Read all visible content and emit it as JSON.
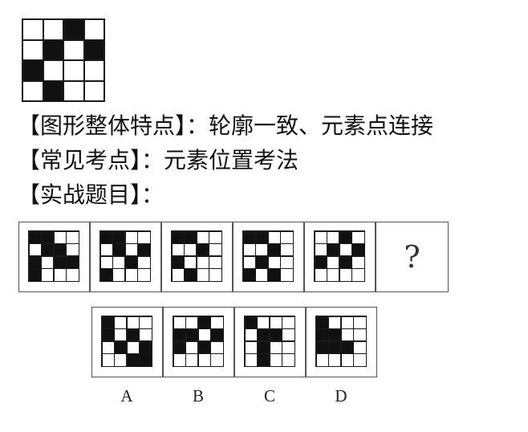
{
  "example": {
    "cells": [
      0,
      0,
      1,
      0,
      0,
      1,
      0,
      1,
      1,
      0,
      0,
      0,
      0,
      1,
      0,
      0
    ]
  },
  "text": {
    "line1": "【图形整体特点】：轮廓一致、元素点连接",
    "line2": "【常见考点】：元素位置考法",
    "line3": "【实战题目】："
  },
  "question": {
    "sequence": [
      [
        1,
        1,
        0,
        0,
        0,
        1,
        1,
        0,
        1,
        0,
        1,
        1,
        1,
        0,
        0,
        0
      ],
      [
        1,
        1,
        0,
        0,
        0,
        1,
        0,
        1,
        0,
        0,
        1,
        0,
        1,
        0,
        0,
        0
      ],
      [
        1,
        1,
        0,
        0,
        0,
        0,
        1,
        0,
        1,
        0,
        0,
        0,
        0,
        1,
        0,
        0
      ],
      [
        1,
        1,
        0,
        0,
        0,
        0,
        1,
        0,
        0,
        1,
        0,
        0,
        1,
        0,
        1,
        0
      ],
      [
        0,
        0,
        1,
        0,
        0,
        1,
        0,
        1,
        1,
        0,
        1,
        0,
        0,
        0,
        0,
        0
      ]
    ],
    "unknown_mark": "?"
  },
  "options": [
    {
      "label": "A",
      "cells": [
        1,
        0,
        0,
        0,
        1,
        0,
        1,
        0,
        0,
        1,
        0,
        1,
        0,
        0,
        1,
        1
      ]
    },
    {
      "label": "B",
      "cells": [
        0,
        0,
        1,
        0,
        1,
        1,
        0,
        1,
        1,
        0,
        1,
        0,
        0,
        0,
        0,
        0
      ]
    },
    {
      "label": "C",
      "cells": [
        1,
        0,
        0,
        0,
        0,
        1,
        1,
        0,
        0,
        1,
        0,
        0,
        0,
        1,
        0,
        0
      ]
    },
    {
      "label": "D",
      "cells": [
        1,
        0,
        0,
        0,
        1,
        1,
        0,
        0,
        1,
        1,
        1,
        0,
        0,
        0,
        0,
        0
      ]
    }
  ]
}
